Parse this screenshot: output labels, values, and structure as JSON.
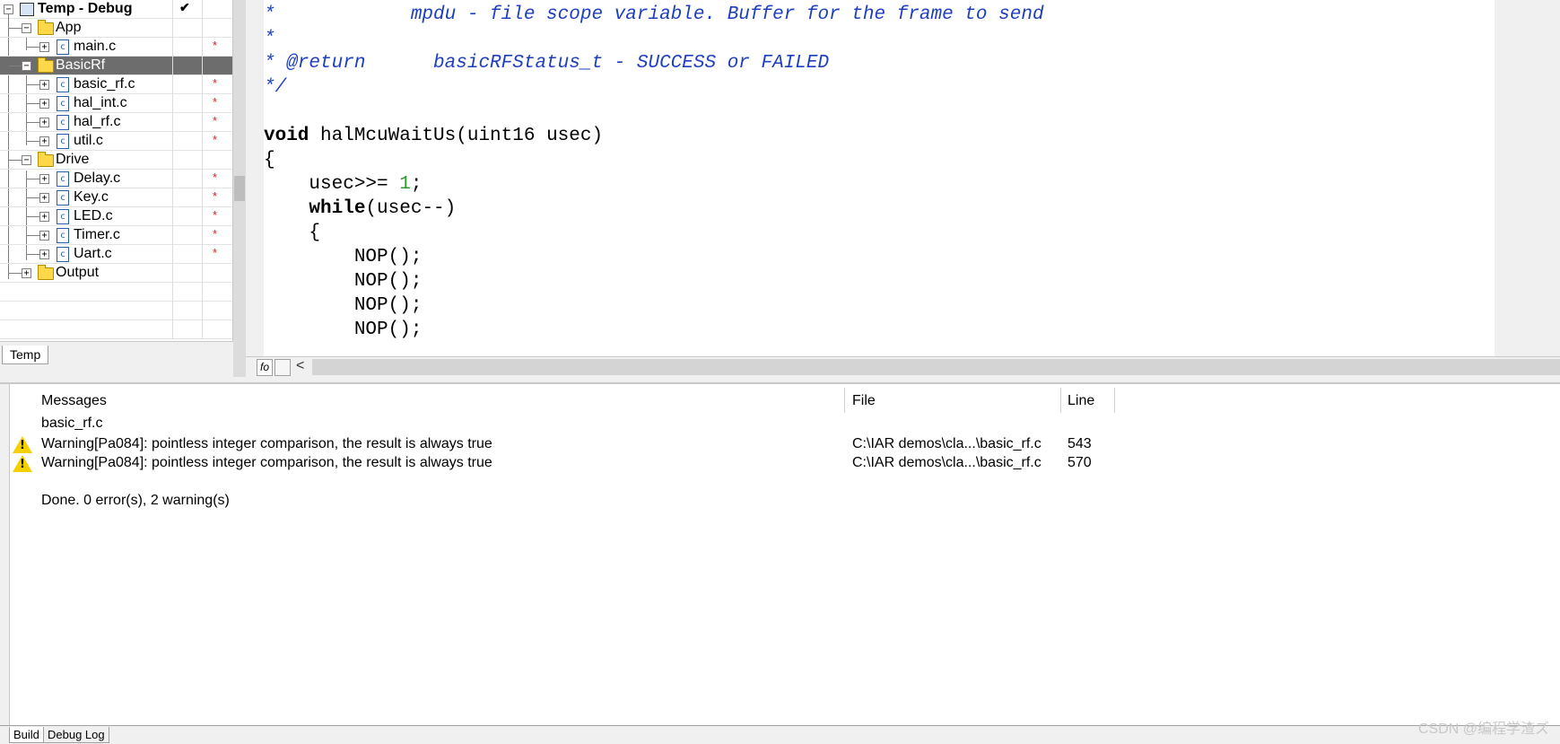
{
  "workspace": {
    "project": "Temp - Debug",
    "check": "✔",
    "modified_mark": "*",
    "items": [
      {
        "label": "App",
        "kind": "folder"
      },
      {
        "label": "main.c",
        "kind": "file",
        "modified": true
      },
      {
        "label": "BasicRf",
        "kind": "folder",
        "selected": true
      },
      {
        "label": "basic_rf.c",
        "kind": "file",
        "modified": true
      },
      {
        "label": "hal_int.c",
        "kind": "file",
        "modified": true
      },
      {
        "label": "hal_rf.c",
        "kind": "file",
        "modified": true
      },
      {
        "label": "util.c",
        "kind": "file",
        "modified": true
      },
      {
        "label": "Drive",
        "kind": "folder"
      },
      {
        "label": "Delay.c",
        "kind": "file",
        "modified": true
      },
      {
        "label": "Key.c",
        "kind": "file",
        "modified": true
      },
      {
        "label": "LED.c",
        "kind": "file",
        "modified": true
      },
      {
        "label": "Timer.c",
        "kind": "file",
        "modified": true
      },
      {
        "label": "Uart.c",
        "kind": "file",
        "modified": true
      },
      {
        "label": "Output",
        "kind": "folder"
      }
    ],
    "tab": "Temp"
  },
  "editor": {
    "lines": [
      {
        "star": "*",
        "text": "            mpdu - file scope variable. Buffer for the frame to send"
      },
      {
        "star": "*",
        "text": ""
      },
      {
        "star": "* @return",
        "text": "      basicRFStatus_t - SUCCESS or FAILED"
      },
      {
        "star": "*/",
        "text": ""
      },
      {
        "kw": "void",
        "text": " halMcuWaitUs(uint16 usec)"
      },
      {
        "text": "{"
      },
      {
        "text": "    usec>>= ",
        "num": "1",
        "tail": ";"
      },
      {
        "kw": "while",
        "text": "(usec--)",
        "indent": "    "
      },
      {
        "text": "    {"
      },
      {
        "text": "        NOP();"
      },
      {
        "text": "        NOP();"
      },
      {
        "text": "        NOP();"
      },
      {
        "text": "        NOP();"
      }
    ],
    "fo_label": "fo",
    "scroll_arrow": "<"
  },
  "messages": {
    "columns": {
      "messages": "Messages",
      "file": "File",
      "line": "Line"
    },
    "group": "basic_rf.c",
    "warnings": [
      {
        "text": "Warning[Pa084]: pointless integer comparison, the result is always true",
        "file": "C:\\IAR demos\\cla...\\basic_rf.c",
        "line": "543"
      },
      {
        "text": "Warning[Pa084]: pointless integer comparison, the result is always true",
        "file": "C:\\IAR demos\\cla...\\basic_rf.c",
        "line": "570"
      }
    ],
    "summary": "Done. 0 error(s), 2 warning(s)"
  },
  "bottom_tabs": {
    "build": "Build",
    "debug_log": "Debug Log"
  },
  "watermark": "CSDN @编程学渣ズ"
}
